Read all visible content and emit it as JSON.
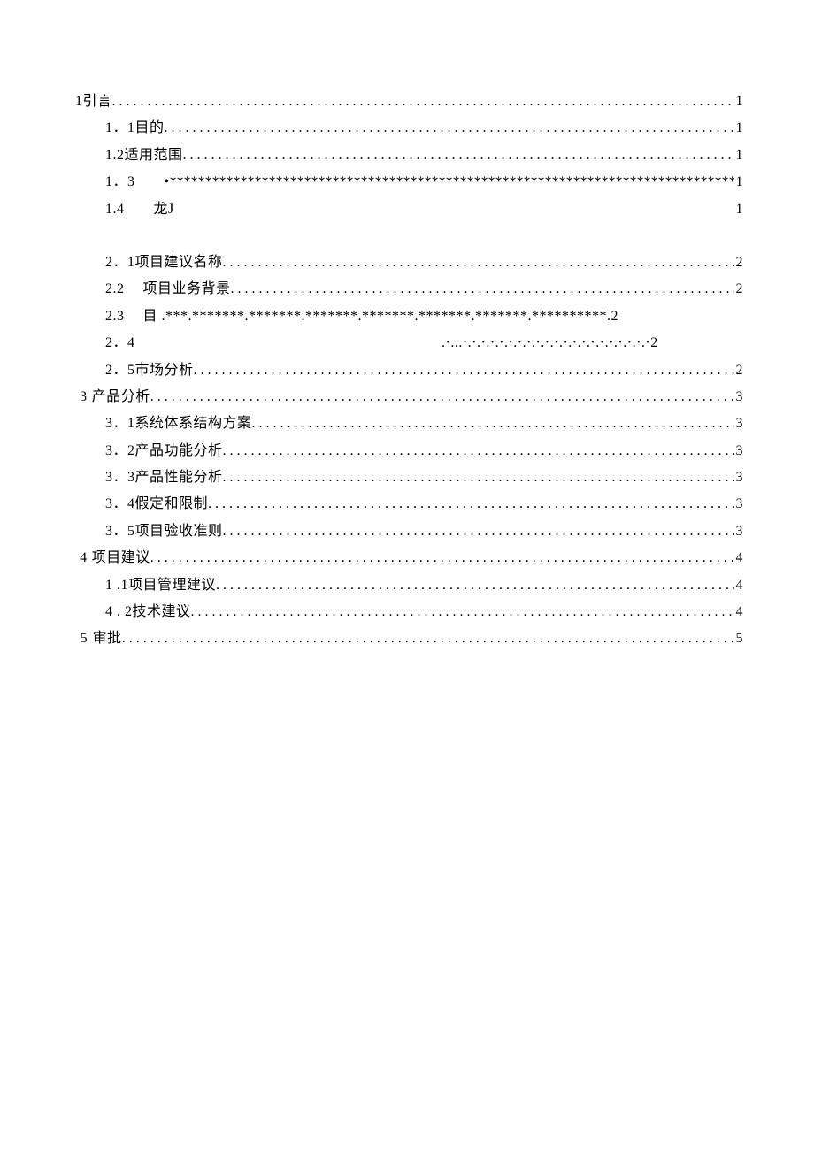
{
  "toc": {
    "items": [
      {
        "level": 0,
        "label": "1引言",
        "page": "1",
        "leader": "dot"
      },
      {
        "level": 1,
        "label": "1．1目的",
        "page": "1",
        "leader": "dot"
      },
      {
        "level": 1,
        "label": "1.2适用范围",
        "page": "1",
        "leader": "dot"
      },
      {
        "level": 1,
        "label": "1．3　　•",
        "page": "1",
        "leader": "ast"
      },
      {
        "level": 1,
        "label": "1.4　　龙J",
        "page": "1",
        "leader": "blank"
      },
      {
        "level": -1,
        "label": "",
        "page": "",
        "leader": "gap"
      },
      {
        "level": 1,
        "label": "2．1项目建议名称",
        "page": "2",
        "leader": "dot"
      },
      {
        "level": 1,
        "label": "2.2　 项目业务背景",
        "page": "2",
        "leader": "dot"
      },
      {
        "level": 1,
        "label": "2.3　 目  .***.*******.*******.*******.*******.*******.*******.**********.2",
        "page": "",
        "leader": "blank"
      },
      {
        "level": 1,
        "label": "2．4　　　　　　　　　　　　　　　　　　　　　.·...·.·.·.·.·.·.·.·.·.·.·.·.·.·.·.·.·.·.·.·.·2",
        "page": "",
        "leader": "blank"
      },
      {
        "level": 1,
        "label": "2．5市场分析",
        "page": "2",
        "leader": "dot"
      },
      {
        "level": 0,
        "num": "3",
        "label": "产品分析",
        "page": "3",
        "leader": "dot"
      },
      {
        "level": 1,
        "label": "3．1系统体系结构方案",
        "page": "3",
        "leader": "dot"
      },
      {
        "level": 1,
        "label": "3．2产品功能分析",
        "page": "3",
        "leader": "dot"
      },
      {
        "level": 1,
        "label": "3．3产品性能分析",
        "page": "3",
        "leader": "dot"
      },
      {
        "level": 1,
        "label": "3．4假定和限制",
        "page": "3",
        "leader": "dot"
      },
      {
        "level": 1,
        "label": "3．5项目验收准则",
        "page": "3",
        "leader": "dot"
      },
      {
        "level": 0,
        "num": "4",
        "label": "项目建议",
        "page": "4",
        "leader": "dot"
      },
      {
        "level": 1,
        "label": "1  .1项目管理建议",
        "page": "4",
        "leader": "dot"
      },
      {
        "level": 1,
        "label": "4  . 2技术建议",
        "page": "4",
        "leader": "dot"
      },
      {
        "level": 0,
        "num": "5",
        "label": "审批",
        "page": "5",
        "leader": "dot"
      }
    ]
  }
}
